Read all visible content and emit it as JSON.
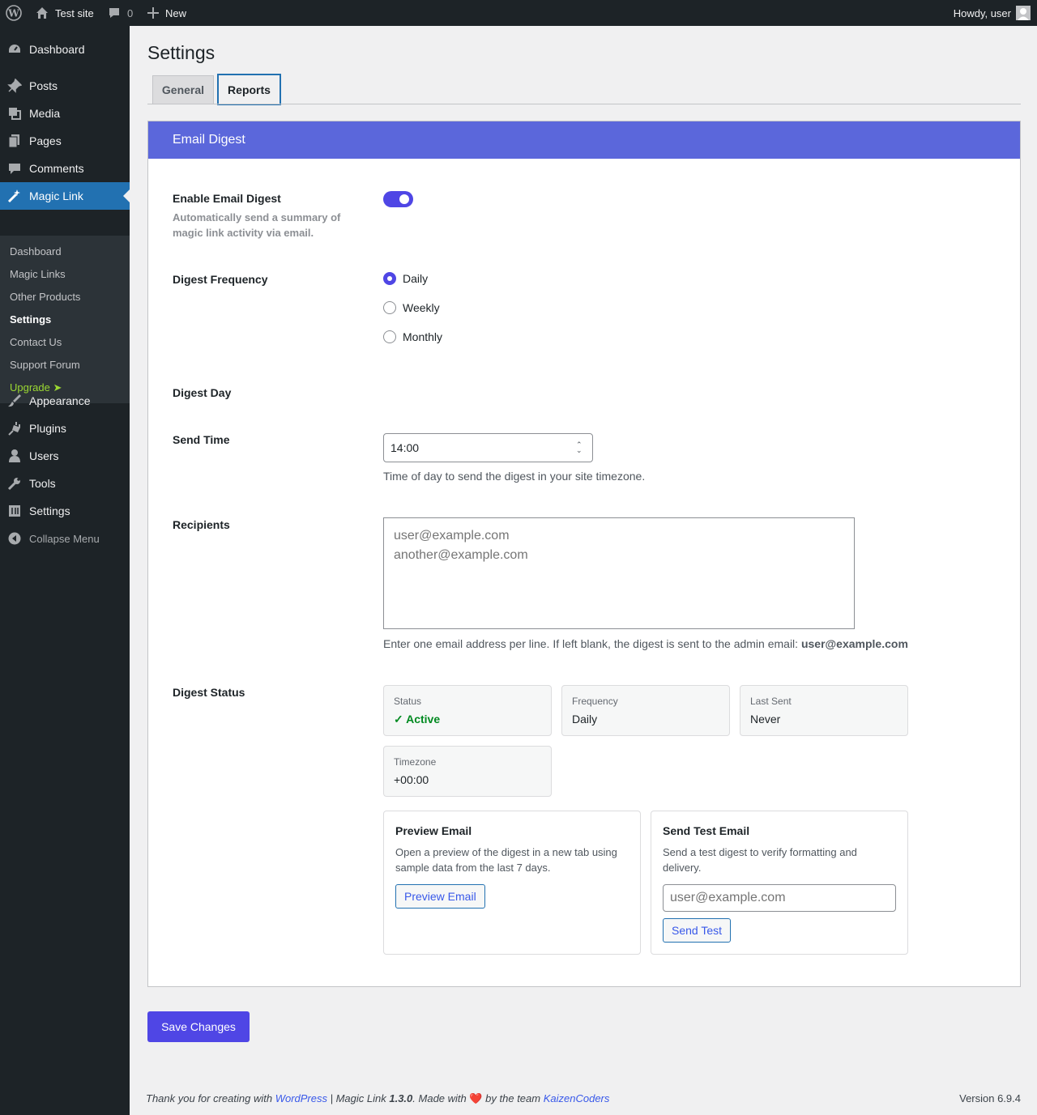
{
  "adminbar": {
    "site_name": "Test site",
    "comments_count": "0",
    "new_label": "New",
    "howdy": "Howdy, user"
  },
  "sidebar": {
    "items": [
      {
        "label": "Dashboard",
        "icon": "dashboard-icon"
      },
      {
        "label": "Posts",
        "icon": "pin-icon"
      },
      {
        "label": "Media",
        "icon": "media-icon"
      },
      {
        "label": "Pages",
        "icon": "pages-icon"
      },
      {
        "label": "Comments",
        "icon": "comment-icon"
      },
      {
        "label": "Magic Link",
        "icon": "wand-icon"
      },
      {
        "label": "Appearance",
        "icon": "brush-icon"
      },
      {
        "label": "Plugins",
        "icon": "plugin-icon"
      },
      {
        "label": "Users",
        "icon": "user-icon"
      },
      {
        "label": "Tools",
        "icon": "wrench-icon"
      },
      {
        "label": "Settings",
        "icon": "settings-icon"
      },
      {
        "label": "Collapse Menu",
        "icon": "collapse-icon"
      }
    ],
    "submenu": [
      "Dashboard",
      "Magic Links",
      "Other Products",
      "Settings",
      "Contact Us",
      "Support Forum",
      "Upgrade ➤"
    ]
  },
  "page": {
    "title": "Settings",
    "tabs": [
      "General",
      "Reports"
    ]
  },
  "section": {
    "title": "Email Digest",
    "enable_label": "Enable Email Digest",
    "enable_desc": "Automatically send a summary of magic link activity via email.",
    "enable_value": true,
    "frequency_label": "Digest Frequency",
    "frequency_options": [
      "Daily",
      "Weekly",
      "Monthly"
    ],
    "frequency_selected": "Daily",
    "day_label": "Digest Day",
    "time_label": "Send Time",
    "time_value": "14:00",
    "time_help": "Time of day to send the digest in your site timezone.",
    "recipients_label": "Recipients",
    "recipients_placeholder": "user@example.com\nanother@example.com",
    "recipients_help": "Enter one email address per line. If left blank, the digest is sent to the admin email: ",
    "admin_email": "user@example.com",
    "status_label": "Digest Status",
    "stats": [
      {
        "key": "Status",
        "value": "✓ Active"
      },
      {
        "key": "Frequency",
        "value": "Daily"
      },
      {
        "key": "Last Sent",
        "value": "Never"
      },
      {
        "key": "Timezone",
        "value": "+00:00"
      }
    ],
    "preview": {
      "title": "Preview Email",
      "desc": "Open a preview of the digest in a new tab using sample data from the last 7 days.",
      "button": "Preview Email"
    },
    "test": {
      "title": "Send Test Email",
      "desc": "Send a test digest to verify formatting and delivery.",
      "placeholder": "user@example.com",
      "button": "Send Test"
    }
  },
  "save_label": "Save Changes",
  "footer": {
    "thanks": "Thank you for creating with ",
    "wp_link": "WordPress",
    "mid": " | Magic Link ",
    "version_bold": "1.3.0",
    "made": ". Made with ",
    "heart": "❤️",
    "by": " by the team ",
    "team_link": "KaizenCoders",
    "version": "Version 6.9.4"
  },
  "colors": {
    "accent": "#4f46e5",
    "header_band": "#5b67db",
    "admin_bg": "#1d2327",
    "active_menu": "#2271b1"
  }
}
